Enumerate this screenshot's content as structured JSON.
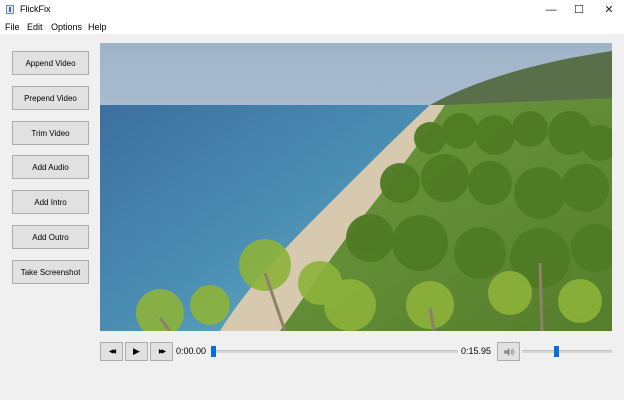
{
  "window": {
    "title": "FlickFix",
    "minimize_glyph": "—",
    "maximize_glyph": "☐",
    "close_glyph": "✕"
  },
  "menu": [
    "File",
    "Edit",
    "Options",
    "Help"
  ],
  "side_buttons": [
    "Append Video",
    "Prepend Video",
    "Trim Video",
    "Add Audio",
    "Add Intro",
    "Add Outro",
    "Take Screenshot"
  ],
  "player": {
    "rewind_glyph": "◀◀",
    "play_glyph": "▶",
    "forward_glyph": "▶▶",
    "current_time": "0:00.00",
    "total_time": "0:15.95",
    "position_fraction": 0.0,
    "volume_fraction": 0.38
  },
  "colors": {
    "accent": "#0a6fd6",
    "button_face": "#e1e1e1",
    "window_bg": "#f0f0f0"
  }
}
